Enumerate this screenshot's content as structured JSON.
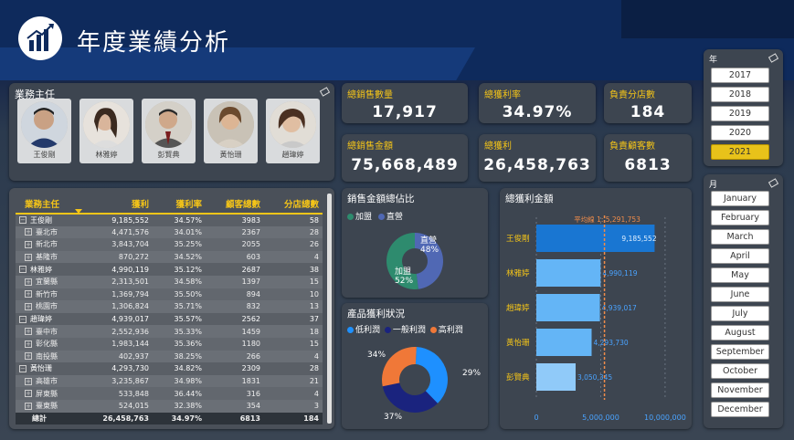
{
  "header": {
    "title": "年度業績分析"
  },
  "managers_panel": {
    "title": "業務主任",
    "people": [
      "王俊剛",
      "林雅婷",
      "彭賢典",
      "黃怡珊",
      "趙瑋婷"
    ]
  },
  "kpis": {
    "total_qty": {
      "label": "總銷售數量",
      "value": "17,917"
    },
    "margin_rate": {
      "label": "總獲利率",
      "value": "34.97%"
    },
    "stores": {
      "label": "負責分店數",
      "value": "184"
    },
    "total_sales": {
      "label": "總銷售金額",
      "value": "75,668,489"
    },
    "total_profit": {
      "label": "總獲利",
      "value": "26,458,763"
    },
    "customers": {
      "label": "負責顧客數",
      "value": "6813"
    }
  },
  "matrix": {
    "headers": [
      "業務主任",
      "獲利",
      "獲利率",
      "顧客總數",
      "分店總數"
    ],
    "rows": [
      {
        "kind": "grp",
        "name": "王俊剛",
        "profit": "9,185,552",
        "rate": "34.57%",
        "cust": "3983",
        "stores": "58"
      },
      {
        "kind": "sub",
        "name": "臺北市",
        "profit": "4,471,576",
        "rate": "34.01%",
        "cust": "2367",
        "stores": "28"
      },
      {
        "kind": "sub",
        "name": "新北市",
        "profit": "3,843,704",
        "rate": "35.25%",
        "cust": "2055",
        "stores": "26"
      },
      {
        "kind": "sub",
        "name": "基隆市",
        "profit": "870,272",
        "rate": "34.52%",
        "cust": "603",
        "stores": "4"
      },
      {
        "kind": "grp",
        "name": "林雅婷",
        "profit": "4,990,119",
        "rate": "35.12%",
        "cust": "2687",
        "stores": "38"
      },
      {
        "kind": "sub",
        "name": "宜蘭縣",
        "profit": "2,313,501",
        "rate": "34.58%",
        "cust": "1397",
        "stores": "15"
      },
      {
        "kind": "sub",
        "name": "新竹市",
        "profit": "1,369,794",
        "rate": "35.50%",
        "cust": "894",
        "stores": "10"
      },
      {
        "kind": "sub",
        "name": "桃園市",
        "profit": "1,306,824",
        "rate": "35.71%",
        "cust": "832",
        "stores": "13"
      },
      {
        "kind": "grp",
        "name": "趙瑋婷",
        "profit": "4,939,017",
        "rate": "35.57%",
        "cust": "2562",
        "stores": "37"
      },
      {
        "kind": "sub",
        "name": "臺中市",
        "profit": "2,552,936",
        "rate": "35.33%",
        "cust": "1459",
        "stores": "18"
      },
      {
        "kind": "sub",
        "name": "彰化縣",
        "profit": "1,983,144",
        "rate": "35.36%",
        "cust": "1180",
        "stores": "15"
      },
      {
        "kind": "sub",
        "name": "南投縣",
        "profit": "402,937",
        "rate": "38.25%",
        "cust": "266",
        "stores": "4"
      },
      {
        "kind": "grp",
        "name": "黃怡珊",
        "profit": "4,293,730",
        "rate": "34.82%",
        "cust": "2309",
        "stores": "28"
      },
      {
        "kind": "sub",
        "name": "高雄市",
        "profit": "3,235,867",
        "rate": "34.98%",
        "cust": "1831",
        "stores": "21"
      },
      {
        "kind": "sub",
        "name": "屏東縣",
        "profit": "533,848",
        "rate": "36.44%",
        "cust": "316",
        "stores": "4"
      },
      {
        "kind": "sub",
        "name": "臺東縣",
        "profit": "524,015",
        "rate": "32.38%",
        "cust": "354",
        "stores": "3"
      },
      {
        "kind": "tot",
        "name": "總計",
        "profit": "26,458,763",
        "rate": "34.97%",
        "cust": "6813",
        "stores": "184"
      }
    ]
  },
  "sales_donut": {
    "title": "銷售金額總佔比",
    "legend": [
      "加盟",
      "直營"
    ],
    "colors": {
      "加盟": "#2e8b6e",
      "直營": "#5068b4"
    },
    "labels": {
      "direct": "直營",
      "direct_pct": "48%",
      "franchise": "加盟",
      "franchise_pct": "52%"
    }
  },
  "profit_donut": {
    "title": "產品獲利狀況",
    "legend": [
      "低利潤",
      "一般利潤",
      "高利潤"
    ],
    "colors": {
      "低利潤": "#1e90ff",
      "一般利潤": "#1a237e",
      "高利潤": "#f07838"
    },
    "labels": {
      "high": "29%",
      "low": "37%",
      "mid": "34%"
    }
  },
  "chart_data": [
    {
      "type": "pie",
      "title": "銷售金額總佔比",
      "labels": [
        "直營",
        "加盟"
      ],
      "values": [
        48,
        52
      ]
    },
    {
      "type": "pie",
      "title": "產品獲利狀況",
      "labels": [
        "低利潤",
        "一般利潤",
        "高利潤"
      ],
      "values": [
        37,
        34,
        29
      ]
    },
    {
      "type": "bar",
      "orientation": "horizontal",
      "title": "總獲利金額",
      "categories": [
        "王俊剛",
        "林雅婷",
        "趙瑋婷",
        "黃怡珊",
        "彭賢典"
      ],
      "values": [
        9185552,
        4990119,
        4939017,
        4293730,
        3050345
      ],
      "value_labels": [
        "9,185,552",
        "4,990,119",
        "4,939,017",
        "4,293,730",
        "3,050,345"
      ],
      "xlim": [
        0,
        11000000
      ],
      "ticks": [
        "0",
        "5,000,000",
        "10,000,000"
      ],
      "reference_line": {
        "label": "平均線 1: 5,291,753",
        "value": 5291753
      }
    }
  ],
  "bar_panel": {
    "title": "總獲利金額",
    "avg_label": "平均線 1: 5,291,753"
  },
  "year_slicer": {
    "title": "年",
    "items": [
      "2017",
      "2018",
      "2019",
      "2020",
      "2021"
    ],
    "selected": "2021"
  },
  "month_slicer": {
    "title": "月",
    "items": [
      "January",
      "February",
      "March",
      "April",
      "May",
      "June",
      "July",
      "August",
      "September",
      "October",
      "November",
      "December"
    ]
  }
}
